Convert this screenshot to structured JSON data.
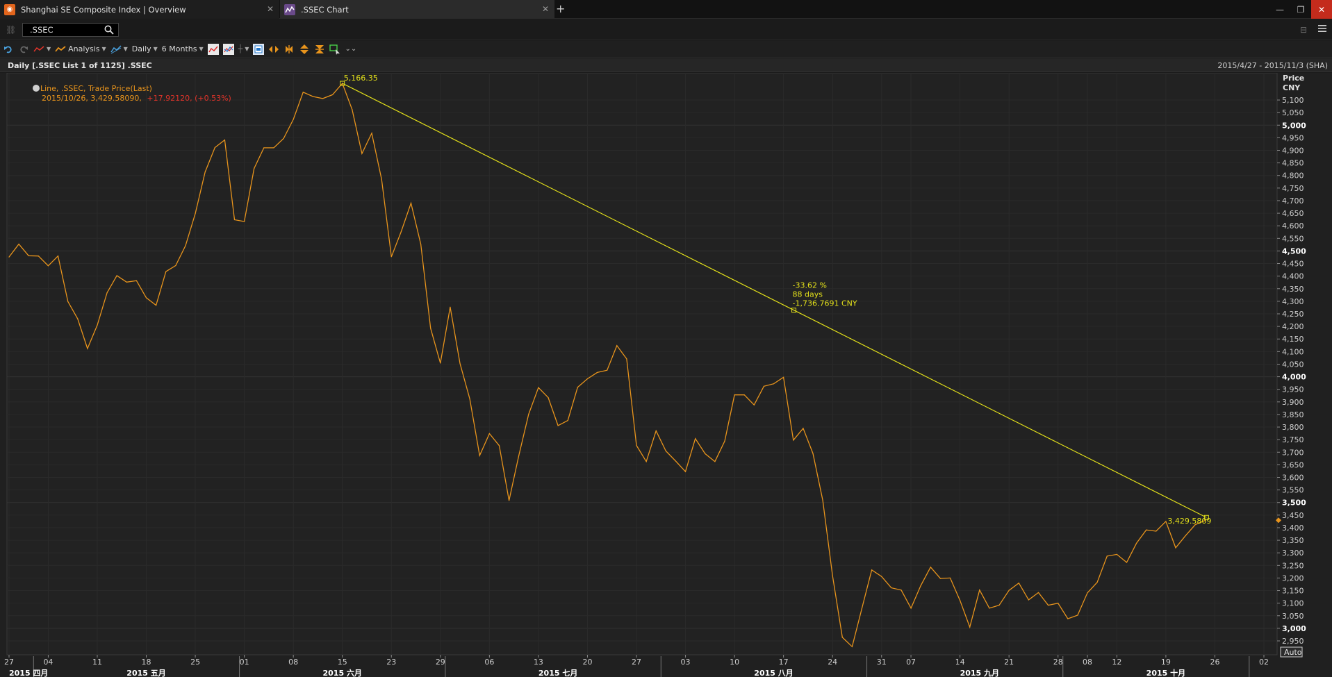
{
  "tabs": [
    {
      "label": "Shanghai SE Composite Index | Overview",
      "icon": "eikon-logo-icon"
    },
    {
      "label": ".SSEC Chart",
      "icon": "chart-icon"
    }
  ],
  "window_buttons": [
    "minimize",
    "restore",
    "close"
  ],
  "search": {
    "value": ".SSEC"
  },
  "toolbar": {
    "analysis_label": "Analysis",
    "interval_label": "Daily",
    "period_label": "6 Months"
  },
  "chart_header": {
    "title": "Daily [.SSEC List 1 of 1125] .SSEC",
    "range": "2015/4/27 - 2015/11/3 (SHA)"
  },
  "legend": {
    "series_label": "Line, .SSEC, Trade Price(Last)",
    "last_point": "2015/10/26, 3,429.58090,",
    "change": "+17.92120, (+0.53%)"
  },
  "annotations": {
    "high_label": "5,166.35",
    "trend_pct": "-33.62 %",
    "trend_days": "88 days",
    "trend_change": "-1,736.7691 CNY",
    "last_label": "3,429.5809"
  },
  "axis": {
    "price_label": "Price",
    "currency_label": "CNY",
    "auto_label": "Auto"
  },
  "colors": {
    "series": "#e8941c",
    "trendline": "#e3e01a",
    "change_red": "#e3342a",
    "background": "#202020"
  },
  "chart_data": {
    "type": "line",
    "ylim": [
      2900,
      5200
    ],
    "y_ticks": [
      {
        "v": 2950,
        "label": "2,950",
        "major": false
      },
      {
        "v": 3000,
        "label": "3,000",
        "major": true
      },
      {
        "v": 3050,
        "label": "3,050",
        "major": false
      },
      {
        "v": 3100,
        "label": "3,100",
        "major": false
      },
      {
        "v": 3150,
        "label": "3,150",
        "major": false
      },
      {
        "v": 3200,
        "label": "3,200",
        "major": false
      },
      {
        "v": 3250,
        "label": "3,250",
        "major": false
      },
      {
        "v": 3300,
        "label": "3,300",
        "major": false
      },
      {
        "v": 3350,
        "label": "3,350",
        "major": false
      },
      {
        "v": 3400,
        "label": "3,400",
        "major": false
      },
      {
        "v": 3450,
        "label": "3,450",
        "major": false
      },
      {
        "v": 3500,
        "label": "3,500",
        "major": true
      },
      {
        "v": 3550,
        "label": "3,550",
        "major": false
      },
      {
        "v": 3600,
        "label": "3,600",
        "major": false
      },
      {
        "v": 3650,
        "label": "3,650",
        "major": false
      },
      {
        "v": 3700,
        "label": "3,700",
        "major": false
      },
      {
        "v": 3750,
        "label": "3,750",
        "major": false
      },
      {
        "v": 3800,
        "label": "3,800",
        "major": false
      },
      {
        "v": 3850,
        "label": "3,850",
        "major": false
      },
      {
        "v": 3900,
        "label": "3,900",
        "major": false
      },
      {
        "v": 3950,
        "label": "3,950",
        "major": false
      },
      {
        "v": 4000,
        "label": "4,000",
        "major": true
      },
      {
        "v": 4050,
        "label": "4,050",
        "major": false
      },
      {
        "v": 4100,
        "label": "4,100",
        "major": false
      },
      {
        "v": 4150,
        "label": "4,150",
        "major": false
      },
      {
        "v": 4200,
        "label": "4,200",
        "major": false
      },
      {
        "v": 4250,
        "label": "4,250",
        "major": false
      },
      {
        "v": 4300,
        "label": "4,300",
        "major": false
      },
      {
        "v": 4350,
        "label": "4,350",
        "major": false
      },
      {
        "v": 4400,
        "label": "4,400",
        "major": false
      },
      {
        "v": 4450,
        "label": "4,450",
        "major": false
      },
      {
        "v": 4500,
        "label": "4,500",
        "major": true
      },
      {
        "v": 4550,
        "label": "4,550",
        "major": false
      },
      {
        "v": 4600,
        "label": "4,600",
        "major": false
      },
      {
        "v": 4650,
        "label": "4,650",
        "major": false
      },
      {
        "v": 4700,
        "label": "4,700",
        "major": false
      },
      {
        "v": 4750,
        "label": "4,750",
        "major": false
      },
      {
        "v": 4800,
        "label": "4,800",
        "major": false
      },
      {
        "v": 4850,
        "label": "4,850",
        "major": false
      },
      {
        "v": 4900,
        "label": "4,900",
        "major": false
      },
      {
        "v": 4950,
        "label": "4,950",
        "major": false
      },
      {
        "v": 5000,
        "label": "5,000",
        "major": true
      },
      {
        "v": 5050,
        "label": "5,050",
        "major": false
      },
      {
        "v": 5100,
        "label": "5,100",
        "major": false
      }
    ],
    "x_ticks": [
      {
        "i": 0,
        "label": "27"
      },
      {
        "i": 4,
        "label": "04"
      },
      {
        "i": 9,
        "label": "11"
      },
      {
        "i": 14,
        "label": "18"
      },
      {
        "i": 19,
        "label": "25"
      },
      {
        "i": 24,
        "label": "01"
      },
      {
        "i": 29,
        "label": "08"
      },
      {
        "i": 34,
        "label": "15"
      },
      {
        "i": 39,
        "label": "23"
      },
      {
        "i": 44,
        "label": "29"
      },
      {
        "i": 49,
        "label": "06"
      },
      {
        "i": 54,
        "label": "13"
      },
      {
        "i": 59,
        "label": "20"
      },
      {
        "i": 64,
        "label": "27"
      },
      {
        "i": 69,
        "label": "03"
      },
      {
        "i": 74,
        "label": "10"
      },
      {
        "i": 79,
        "label": "17"
      },
      {
        "i": 84,
        "label": "24"
      },
      {
        "i": 89,
        "label": "31"
      },
      {
        "i": 92,
        "label": "07"
      },
      {
        "i": 97,
        "label": "14"
      },
      {
        "i": 102,
        "label": "21"
      },
      {
        "i": 107,
        "label": "28"
      },
      {
        "i": 110,
        "label": "08"
      },
      {
        "i": 113,
        "label": "12"
      },
      {
        "i": 118,
        "label": "19"
      },
      {
        "i": 123,
        "label": "26"
      },
      {
        "i": 128,
        "label": "02"
      }
    ],
    "months": [
      {
        "i": 2,
        "label": "2015 四月"
      },
      {
        "i": 14,
        "label": "2015 五月"
      },
      {
        "i": 34,
        "label": "2015 六月"
      },
      {
        "i": 56,
        "label": "2015 七月"
      },
      {
        "i": 78,
        "label": "2015 八月"
      },
      {
        "i": 99,
        "label": "2015 九月"
      },
      {
        "i": 118,
        "label": "2015 十月"
      }
    ],
    "month_dividers": [
      3,
      24,
      45,
      67,
      88,
      108,
      127
    ],
    "series": [
      {
        "name": ".SSEC",
        "values": [
          4476,
          4527,
          4481,
          4480,
          4441,
          4480,
          4299,
          4230,
          4112,
          4205,
          4334,
          4402,
          4376,
          4382,
          4314,
          4284,
          4418,
          4442,
          4521,
          4649,
          4814,
          4911,
          4941,
          4624,
          4617,
          4828,
          4910,
          4910,
          4947,
          5023,
          5131,
          5114,
          5106,
          5121,
          5166,
          5062,
          4887,
          4968,
          4785,
          4477,
          4577,
          4690,
          4527,
          4193,
          4054,
          4277,
          4053,
          3912,
          3687,
          3774,
          3726,
          3508,
          3687,
          3851,
          3957,
          3917,
          3806,
          3826,
          3958,
          3992,
          4017,
          4026,
          4124,
          4071,
          3727,
          3663,
          3785,
          3705,
          3665,
          3623,
          3754,
          3694,
          3663,
          3744,
          3928,
          3928,
          3888,
          3962,
          3972,
          3998,
          3748,
          3795,
          3695,
          3509,
          3209,
          2964,
          2927,
          3080,
          3232,
          3206,
          3161,
          3152,
          3080,
          3170,
          3243,
          3198,
          3200,
          3111,
          3005,
          3152,
          3080,
          3092,
          3151,
          3180,
          3113,
          3142,
          3092,
          3100,
          3038,
          3052,
          3141,
          3183,
          3287,
          3294,
          3262,
          3338,
          3391,
          3386,
          3425,
          3320,
          3368,
          3412,
          3429
        ]
      }
    ],
    "trendline": {
      "from_index": 34,
      "from_value": 5166.35,
      "to_index": 122,
      "to_value": 3429.58
    }
  }
}
